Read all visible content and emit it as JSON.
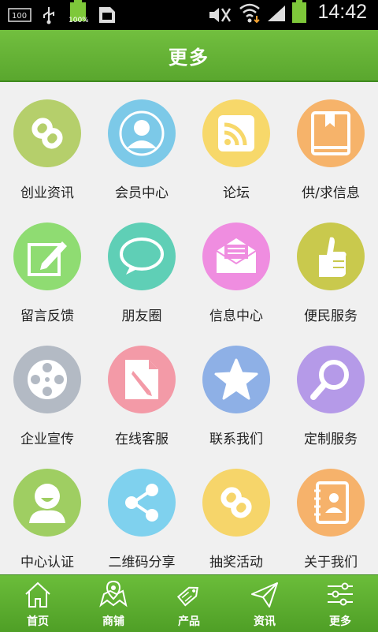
{
  "status_bar": {
    "time": "14:42",
    "battery_small_label": "100%",
    "icons": [
      "100-icon",
      "usb-icon",
      "battery-full-icon",
      "sim-icon",
      "mute-icon",
      "wifi-icon",
      "signal-icon",
      "battery-icon"
    ]
  },
  "header": {
    "title": "更多"
  },
  "tiles": [
    {
      "label": "创业资讯",
      "icon": "link-icon",
      "color": "#b5cf6b"
    },
    {
      "label": "会员中心",
      "icon": "user-icon",
      "color": "#7cc9e8"
    },
    {
      "label": "论坛",
      "icon": "rss-icon",
      "color": "#f7d86a"
    },
    {
      "label": "供/求信息",
      "icon": "book-icon",
      "color": "#f6b36a"
    },
    {
      "label": "留言反馈",
      "icon": "edit-icon",
      "color": "#8fdc72"
    },
    {
      "label": "朋友圈",
      "icon": "chat-bubble-icon",
      "color": "#5fcfb6"
    },
    {
      "label": "信息中心",
      "icon": "mail-icon",
      "color": "#ef8de0"
    },
    {
      "label": "便民服务",
      "icon": "thumbs-up-icon",
      "color": "#c9c94d"
    },
    {
      "label": "企业宣传",
      "icon": "film-reel-icon",
      "color": "#b3bac4"
    },
    {
      "label": "在线客服",
      "icon": "document-pen-icon",
      "color": "#f39aa7"
    },
    {
      "label": "联系我们",
      "icon": "star-icon",
      "color": "#8eb0e6"
    },
    {
      "label": "定制服务",
      "icon": "magnifier-icon",
      "color": "#b59ae8"
    },
    {
      "label": "中心认证",
      "icon": "smiley-user-icon",
      "color": "#9fce62"
    },
    {
      "label": "二维码分享",
      "icon": "share-icon",
      "color": "#7fd1ee"
    },
    {
      "label": "抽奖活动",
      "icon": "link-icon",
      "color": "#f6d56a"
    },
    {
      "label": "关于我们",
      "icon": "contacts-book-icon",
      "color": "#f6b26b"
    }
  ],
  "bottom_nav": [
    {
      "label": "首页",
      "icon": "home-icon"
    },
    {
      "label": "商铺",
      "icon": "map-icon"
    },
    {
      "label": "产品",
      "icon": "sale-tag-icon"
    },
    {
      "label": "资讯",
      "icon": "send-icon"
    },
    {
      "label": "更多",
      "icon": "settings-sliders-icon"
    }
  ]
}
